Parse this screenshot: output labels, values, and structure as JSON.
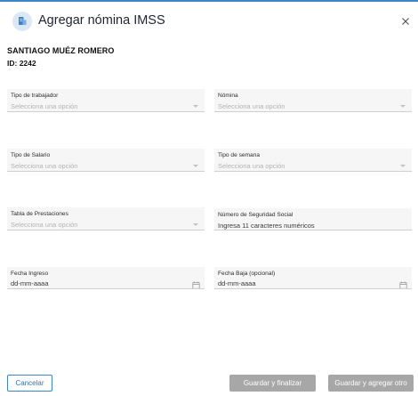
{
  "dialog": {
    "title": "Agregar nómina IMSS",
    "icon": "document-building-icon",
    "close_icon": "close-icon"
  },
  "employee": {
    "name": "SANTIAGO MUÉZ ROMERO",
    "id_text": "ID: 2242"
  },
  "form": {
    "tipo_trabajador": {
      "label": "Tipo de trabajador",
      "placeholder": "Selecciona una opción"
    },
    "nomina": {
      "label": "Nómina",
      "placeholder": "Selecciona una opción"
    },
    "tipo_salario": {
      "label": "Tipo de Salario",
      "placeholder": "Selecciona una opción"
    },
    "tipo_semana": {
      "label": "Tipo de semana",
      "placeholder": "Selecciona una opción"
    },
    "tabla_prestaciones": {
      "label": "Tabla de Prestaciones",
      "placeholder": "Selecciona una opción"
    },
    "nss": {
      "label": "Número de Seguridad Social",
      "placeholder": "Ingresa 11 caracteres numéricos"
    },
    "fecha_ingreso": {
      "label": "Fecha Ingreso",
      "placeholder": "dd-mm-aaaa"
    },
    "fecha_baja": {
      "label": "Fecha Baja (opcional)",
      "placeholder": "dd-mm-aaaa"
    }
  },
  "footer": {
    "cancel_label": "Cancelar",
    "finish_label": "Guardar y finalizar",
    "save_another_label": "Guardar y agregar otro"
  },
  "colors": {
    "accent": "#3d86c6",
    "button_disabled": "#a7a7a7",
    "field_background": "#f6f6f6"
  }
}
